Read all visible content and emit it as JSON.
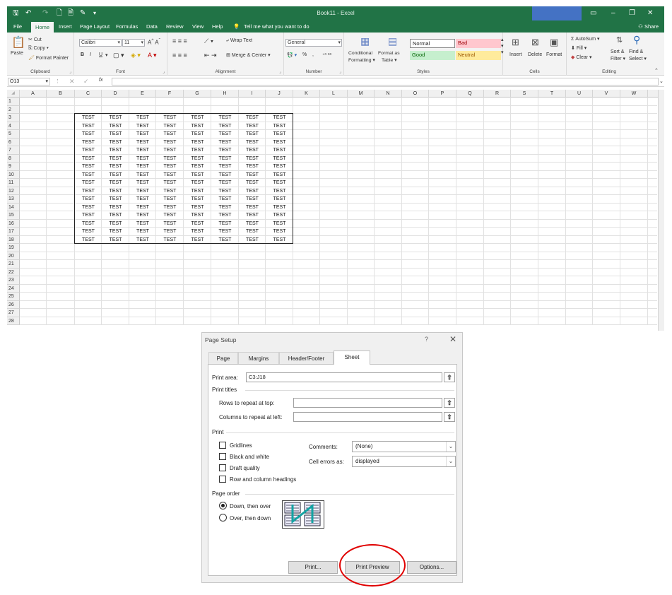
{
  "excel": {
    "window_title": "Book11 - Excel",
    "menu_tabs": [
      "File",
      "Home",
      "Insert",
      "Page Layout",
      "Formulas",
      "Data",
      "Review",
      "View",
      "Help"
    ],
    "tell_me": "Tell me what you want to do",
    "share": "Share",
    "ribbon": {
      "clipboard": {
        "label": "Clipboard",
        "paste": "Paste",
        "cut": "Cut",
        "copy": "Copy",
        "format_painter": "Format Painter"
      },
      "font": {
        "label": "Font",
        "font_name": "Calibri",
        "font_size": "11",
        "bold": "B",
        "italic": "I",
        "underline": "U"
      },
      "alignment": {
        "label": "Alignment",
        "wrap_text": "Wrap Text",
        "merge_center": "Merge & Center"
      },
      "number": {
        "label": "Number",
        "format": "General",
        "percent": "%",
        "comma": ","
      },
      "styles": {
        "label": "Styles",
        "conditional": "Conditional",
        "formatting": "Formatting",
        "format_as": "Format as",
        "table": "Table",
        "normal": "Normal",
        "bad": "Bad",
        "good": "Good",
        "neutral": "Neutral"
      },
      "cells": {
        "label": "Cells",
        "insert": "Insert",
        "delete": "Delete",
        "format": "Format"
      },
      "editing": {
        "label": "Editing",
        "autosum": "AutoSum",
        "fill": "Fill",
        "clear": "Clear",
        "sort_filter": "Sort &",
        "filter": "Filter",
        "find_select": "Find &",
        "select": "Select"
      }
    },
    "name_box": "O13",
    "fx": "fx",
    "columns": [
      "A",
      "B",
      "C",
      "D",
      "E",
      "F",
      "G",
      "H",
      "I",
      "J",
      "K",
      "L",
      "M",
      "N",
      "O",
      "P",
      "Q",
      "R",
      "S",
      "T",
      "U",
      "V",
      "W"
    ],
    "rows": [
      "1",
      "2",
      "3",
      "4",
      "5",
      "6",
      "7",
      "8",
      "9",
      "10",
      "11",
      "12",
      "13",
      "14",
      "15",
      "16",
      "17",
      "18",
      "19",
      "20",
      "21",
      "22",
      "23",
      "24",
      "25",
      "26",
      "27",
      "28"
    ],
    "cell_value": "TEST",
    "data_range": {
      "first_row": 3,
      "last_row": 18,
      "first_col": "C",
      "last_col": "J"
    }
  },
  "dialog": {
    "title": "Page Setup",
    "help": "?",
    "close": "✕",
    "tabs": [
      "Page",
      "Margins",
      "Header/Footer",
      "Sheet"
    ],
    "active_tab": "Sheet",
    "print_area_label": "Print area:",
    "print_area_value": "C3:J18",
    "print_titles_label": "Print titles",
    "rows_repeat_label": "Rows to repeat at top:",
    "cols_repeat_label": "Columns to repeat at left:",
    "print_label": "Print",
    "gridlines": "Gridlines",
    "black_white": "Black and white",
    "draft_quality": "Draft quality",
    "row_col_headings": "Row and column headings",
    "comments_label": "Comments:",
    "comments_value": "(None)",
    "cell_errors_label": "Cell errors as:",
    "cell_errors_value": "displayed",
    "page_order_label": "Page order",
    "down_then_over": "Down, then over",
    "over_then_down": "Over, then down",
    "print_btn": "Print...",
    "print_preview_btn": "Print Preview",
    "options_btn": "Options..."
  }
}
